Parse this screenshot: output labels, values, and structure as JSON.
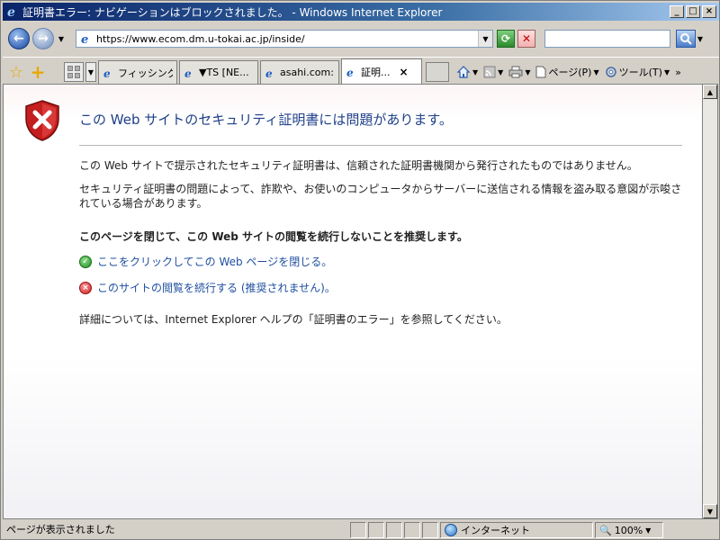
{
  "window": {
    "title": "証明書エラー: ナビゲーションはブロックされました。 - Windows Internet Explorer"
  },
  "address": {
    "url": "https://www.ecom.dm.u-tokai.ac.jp/inside/"
  },
  "search": {
    "placeholder": ""
  },
  "tabs": [
    {
      "label": "フィッシング..."
    },
    {
      "label": "▼TS [NE..."
    },
    {
      "label": "asahi.com:..."
    },
    {
      "label": "証明...",
      "active": true
    }
  ],
  "commands": {
    "page_label": "ページ(P)",
    "tools_label": "ツール(T)"
  },
  "content": {
    "heading": "この Web サイトのセキュリティ証明書には問題があります。",
    "para1": "この Web サイトで提示されたセキュリティ証明書は、信頼された証明書機関から発行されたものではありません。",
    "para2": "セキュリティ証明書の問題によって、詐欺や、お使いのコンピュータからサーバーに送信される情報を盗み取る意図が示唆されている場合があります。",
    "recommend": "このページを閉じて、この Web サイトの閲覧を続行しないことを推奨します。",
    "link_close": "ここをクリックしてこの Web ページを閉じる。",
    "link_continue": "このサイトの閲覧を続行する (推奨されません)。",
    "more_info": "詳細については、Internet Explorer ヘルプの「証明書のエラー」を参照してください。"
  },
  "status": {
    "text": "ページが表示されました",
    "zone": "インターネット",
    "zoom": "100%"
  }
}
